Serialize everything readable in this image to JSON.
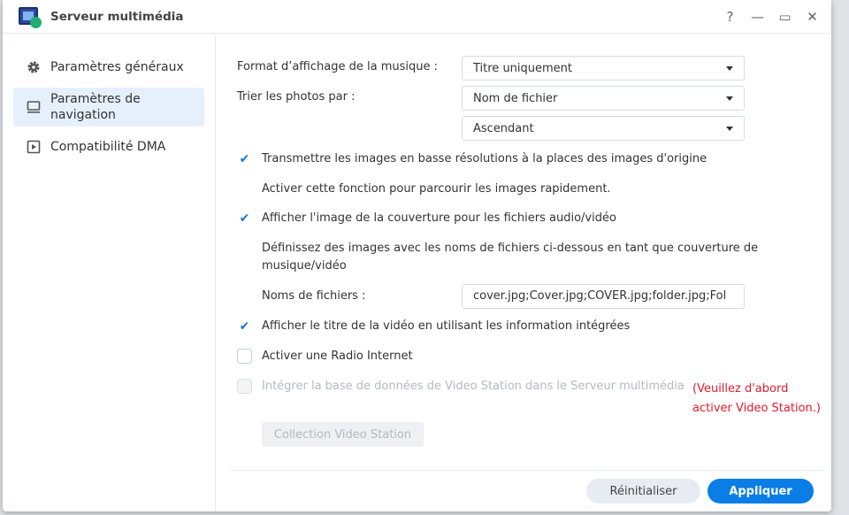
{
  "window": {
    "title": "Serveur multimédia",
    "controls": [
      "?",
      "—",
      "▭",
      "✕"
    ]
  },
  "sidebar": {
    "items": [
      {
        "label": "Paramètres généraux",
        "icon": "gear-icon"
      },
      {
        "label": "Paramètres de navigation",
        "icon": "monitor-icon",
        "active": true
      },
      {
        "label": "Compatibilité DMA",
        "icon": "play-icon"
      }
    ]
  },
  "form": {
    "music_format": {
      "label": "Format d’affichage de la musique :",
      "value": "Titre uniquement"
    },
    "sort_photos": {
      "label": "Trier les photos par :",
      "value": "Nom de fichier",
      "order": "Ascendant"
    },
    "low_res": {
      "label": "Transmettre les images en basse résolutions à la places des images d'origine",
      "checked": true,
      "desc": "Activer cette fonction pour parcourir les images rapidement."
    },
    "cover": {
      "label": "Afficher l'image de la couverture pour les fichiers audio/vidéo",
      "checked": true,
      "desc": "Définissez des images avec les noms de fichiers ci-dessous en tant que couverture de musique/vidéo"
    },
    "filenames": {
      "label": "Noms de fichiers :",
      "value": "cover.jpg;Cover.jpg;COVER.jpg;folder.jpg;Fol"
    },
    "video_title": {
      "label": "Afficher le titre de la vidéo en utilisant les information intégrées",
      "checked": true
    },
    "radio": {
      "label": "Activer une Radio Internet",
      "checked": false
    },
    "video_station": {
      "label": "Intégrer la base de données de Video Station dans le Serveur multimédia",
      "checked": false,
      "disabled": true,
      "warning": "(Veuillez d'abord activer Video Station.)"
    },
    "collection_button": "Collection Video Station"
  },
  "footer": {
    "reset": "Réinitialiser",
    "apply": "Appliquer"
  },
  "colors": {
    "accent": "#0b7de6",
    "warning": "#e6182b",
    "active_nav": "#e5f0fc"
  }
}
